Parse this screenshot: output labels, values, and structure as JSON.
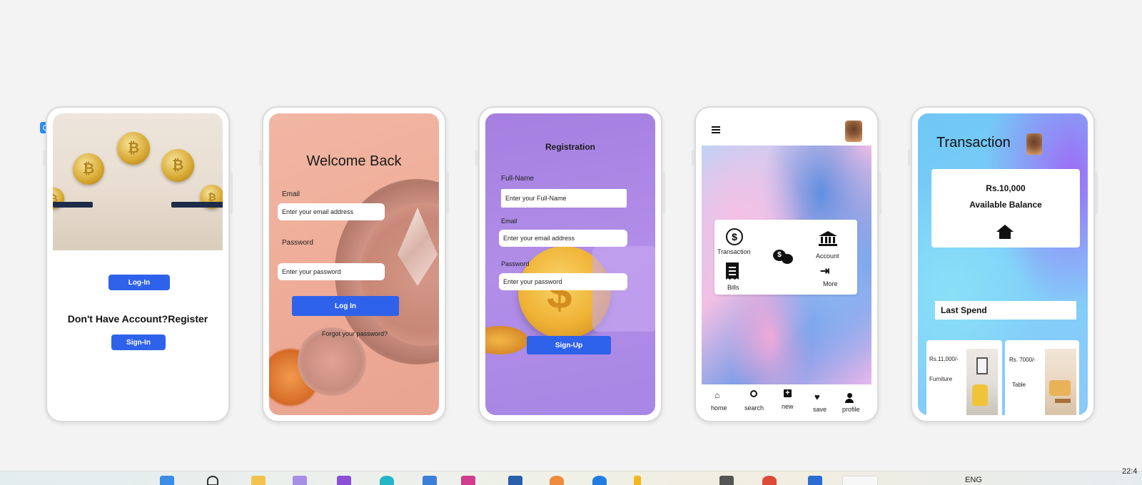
{
  "colors": {
    "accent": "#2f62ea",
    "page_bg": "#f3f3f3"
  },
  "phone1": {
    "login_label": "Log-In",
    "register_text": "Don't Have Account?Register",
    "signin_label": "Sign-In"
  },
  "phone2": {
    "title": "Welcome Back",
    "email_label": "Email",
    "email_placeholder": "Enter your email address",
    "password_label": "Password",
    "password_placeholder": "Enter your password",
    "login_label": "Log In",
    "forgot_label": "Forgot your password?"
  },
  "phone3": {
    "title": "Registration",
    "fullname_label": "Full-Name",
    "fullname_placeholder": "Enter your Full-Name",
    "email_label": "Email",
    "email_placeholder": "Enter your email address",
    "password_label": "Password",
    "password_placeholder": "Enter your password",
    "signup_label": "Sign-Up"
  },
  "phone4": {
    "menu_items": {
      "transaction": "Transaction",
      "account": "Account",
      "bills": "Bills",
      "more": "More"
    },
    "nav": {
      "home": "home",
      "search": "search",
      "new": "new",
      "save": "save",
      "profile": "profile"
    }
  },
  "phone5": {
    "title": "Transaction",
    "balance": "Rs.10,000",
    "balance_label": "Available Balance",
    "last_spend": "Last Spend",
    "items": [
      {
        "price": "Rs.11,000/-",
        "name": "Furniture"
      },
      {
        "price": "Rs. 7000/-",
        "name": "Table"
      }
    ]
  },
  "taskbar": {
    "lang": "ENG",
    "time": "22:4"
  }
}
